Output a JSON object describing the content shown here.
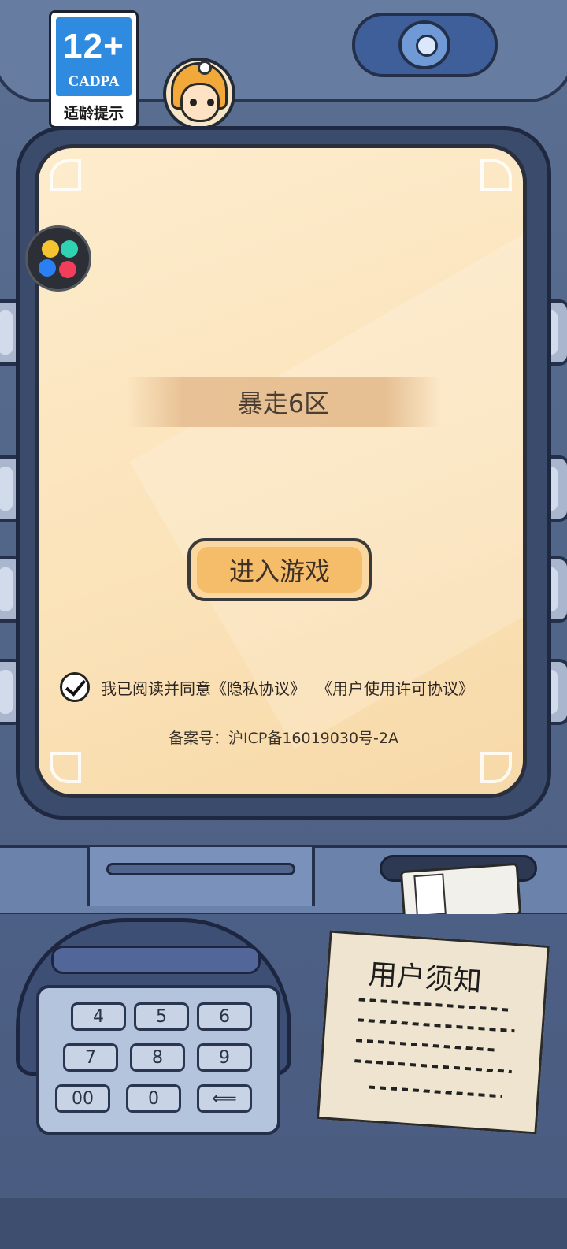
{
  "age_rating": {
    "age_label": "12+",
    "org_label": "CADPA",
    "tip_label": "适龄提示"
  },
  "server": {
    "name": "暴走6区"
  },
  "actions": {
    "enter_game_label": "进入游戏"
  },
  "agreement": {
    "checked": true,
    "prefix": "我已阅读并同意",
    "privacy_link": "《隐私协议》",
    "license_link": "《用户使用许可协议》"
  },
  "icp": {
    "text": "备案号：沪ICP备16019030号-2A"
  },
  "keypad": {
    "keys": [
      "4",
      "5",
      "6",
      "7",
      "8",
      "9",
      "00",
      "0",
      "⟸"
    ]
  },
  "notice": {
    "title": "用户须知"
  },
  "colors": {
    "screen_bg": "#fbe3ba",
    "button_fill": "#f5bd6a",
    "machine_body": "#52668a",
    "badge_blue": "#2f8be0"
  }
}
